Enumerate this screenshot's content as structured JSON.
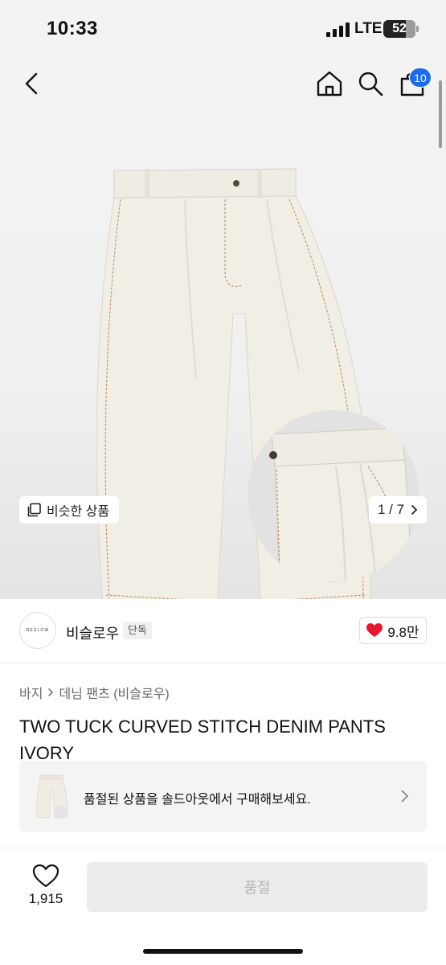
{
  "status_bar": {
    "time": "10:33",
    "network": "LTE",
    "battery_level": "52"
  },
  "header": {
    "back_icon": "chevron-left-icon",
    "home_icon": "home-icon",
    "search_icon": "search-icon",
    "cart_icon": "cart-icon",
    "cart_badge": "10",
    "accent_color": "#1b6cf0"
  },
  "gallery": {
    "similar_label": "비슷한 상품",
    "page_indicator": "1 / 7"
  },
  "brand": {
    "logo_text": "RESLOW",
    "name": "비슬로우",
    "tag": "단독",
    "likes": "9.8만",
    "heart_color": "#e8182d"
  },
  "breadcrumb": {
    "category": "바지",
    "subcategory": "데님 팬츠 (비슬로우)"
  },
  "product": {
    "title": "TWO TUCK CURVED STITCH DENIM PANTS IVORY"
  },
  "soldout_banner": {
    "message": "품절된 상품을 솔드아웃에서 구매해보세요."
  },
  "bottom_bar": {
    "wish_count": "1,915",
    "buy_label": "품절"
  }
}
